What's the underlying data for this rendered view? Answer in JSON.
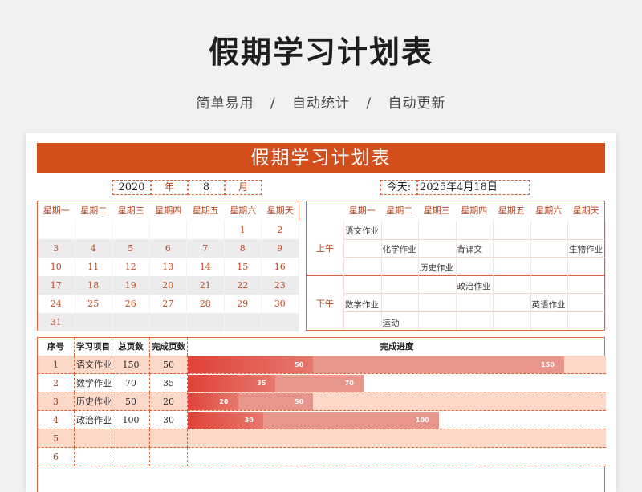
{
  "hero": {
    "title": "假期学习计划表",
    "tags": [
      "简单易用",
      "自动统计",
      "自动更新"
    ],
    "separator": "/"
  },
  "sheet": {
    "banner": "假期学习计划表",
    "year": "2020",
    "year_label": "年",
    "month": "8",
    "month_label": "月",
    "today_label": "今天:",
    "today_value": "2025年4月18日"
  },
  "calendar": {
    "weekdays": [
      "星期一",
      "星期二",
      "星期三",
      "星期四",
      "星期五",
      "星期六",
      "星期天"
    ],
    "weeks": [
      [
        "",
        "",
        "",
        "",
        "",
        "1",
        "2"
      ],
      [
        "3",
        "4",
        "5",
        "6",
        "7",
        "8",
        "9"
      ],
      [
        "10",
        "11",
        "12",
        "13",
        "14",
        "15",
        "16"
      ],
      [
        "17",
        "18",
        "19",
        "20",
        "21",
        "22",
        "23"
      ],
      [
        "24",
        "25",
        "26",
        "27",
        "28",
        "29",
        "30"
      ],
      [
        "31",
        "",
        "",
        "",
        "",
        "",
        ""
      ]
    ]
  },
  "schedule": {
    "weekdays": [
      "星期一",
      "星期二",
      "星期三",
      "星期四",
      "星期五",
      "星期六",
      "星期天"
    ],
    "morning_label": "上午",
    "afternoon_label": "下午",
    "entries": [
      {
        "text": "语文作业",
        "col": 0,
        "row": 0
      },
      {
        "text": "化学作业",
        "col": 1,
        "row": 1
      },
      {
        "text": "背课文",
        "col": 3,
        "row": 1
      },
      {
        "text": "生物作业",
        "col": 6,
        "row": 1
      },
      {
        "text": "历史作业",
        "col": 2,
        "row": 2
      },
      {
        "text": "政治作业",
        "col": 3,
        "row": 3
      },
      {
        "text": "数学作业",
        "col": 0,
        "row": 4
      },
      {
        "text": "英语作业",
        "col": 5,
        "row": 4
      },
      {
        "text": "运动",
        "col": 1,
        "row": 5
      }
    ]
  },
  "progress": {
    "headers": {
      "idx": "序号",
      "subject": "学习项目",
      "total": "总页数",
      "done": "完成页数",
      "bar": "完成进度"
    },
    "max_pages": 150,
    "rows": [
      {
        "idx": "1",
        "subject": "语文作业",
        "total": "150",
        "done": "50"
      },
      {
        "idx": "2",
        "subject": "数学作业",
        "total": "70",
        "done": "35"
      },
      {
        "idx": "3",
        "subject": "历史作业",
        "total": "50",
        "done": "20"
      },
      {
        "idx": "4",
        "subject": "政治作业",
        "total": "100",
        "done": "30"
      },
      {
        "idx": "5",
        "subject": "",
        "total": "",
        "done": ""
      },
      {
        "idx": "6",
        "subject": "",
        "total": "",
        "done": ""
      }
    ],
    "colors": {
      "row_odd": "#fcd8c8",
      "row_even": "#ffffff",
      "done": "#e0423a",
      "total": "#e8958c"
    }
  }
}
